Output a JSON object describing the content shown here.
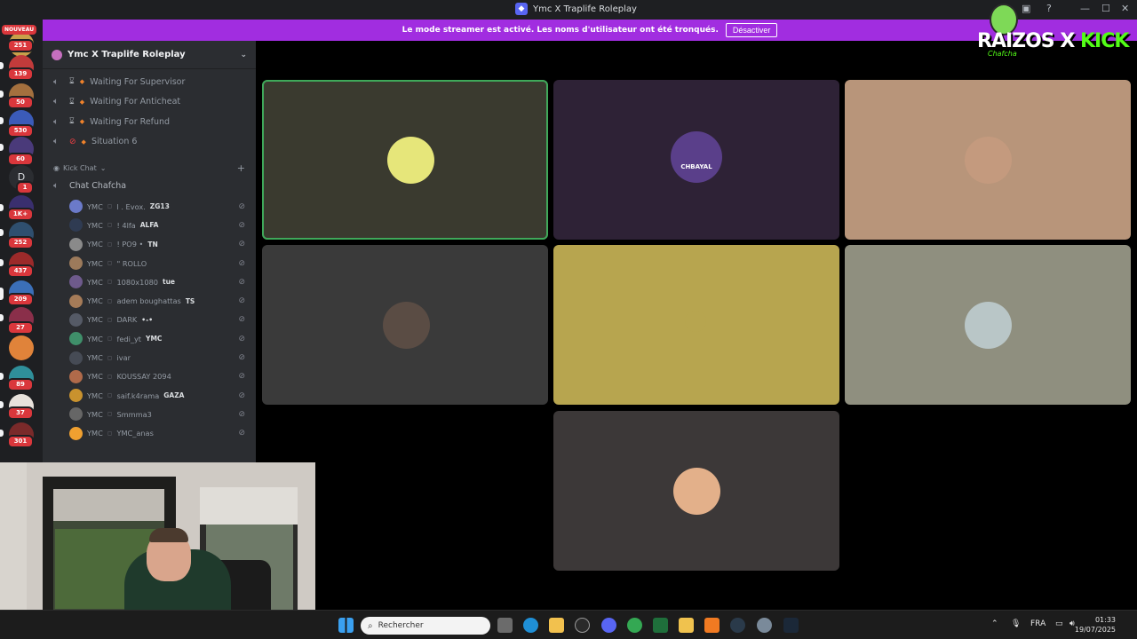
{
  "window": {
    "title": "Ymc X Traplife Roleplay",
    "minimize": "—",
    "maximize": "☐",
    "close": "✕"
  },
  "banner": {
    "text": "Le mode streamer est activé. Les noms d'utilisateur ont été tronqués.",
    "button": "Désactiver"
  },
  "overlay": {
    "left": "RAIZOS",
    "x": "X",
    "right": "KICK",
    "sub": "Chafcha"
  },
  "rail": {
    "new_badge": "NOUVEAU",
    "badges": [
      "251",
      "139",
      "50",
      "530",
      "60",
      "1",
      "1K+",
      "252",
      "437",
      "209",
      "27",
      "89",
      "37",
      "301"
    ],
    "letter": "D"
  },
  "server": {
    "name": "Ymc X Traplife Roleplay",
    "voice_channels": [
      {
        "label": "Waiting For Supervisor"
      },
      {
        "label": "Waiting For Anticheat"
      },
      {
        "label": "Waiting For Refund"
      },
      {
        "label": "Situation 6"
      }
    ],
    "category": "Kick Chat",
    "chat_channel": "Chat Chafcha",
    "members": [
      {
        "prefix": "YMC",
        "name": "l . Evox.",
        "tag": "ZG13",
        "color": "#6b7ac9"
      },
      {
        "prefix": "YMC",
        "name": "! 4lfa",
        "tag": "ALFA",
        "color": "#2f3b52"
      },
      {
        "prefix": "YMC",
        "name": "! PO9 •",
        "tag": "TN",
        "color": "#8a8a8a"
      },
      {
        "prefix": "YMC",
        "name": "\" ROLLO",
        "tag": "",
        "color": "#9c7a5b"
      },
      {
        "prefix": "YMC",
        "name": "1080x1080",
        "tag": "tue",
        "color": "#6e5a8c"
      },
      {
        "prefix": "YMC",
        "name": "adem boughattas",
        "tag": "TS",
        "color": "#a57b58"
      },
      {
        "prefix": "YMC",
        "name": "DARK",
        "tag": "•-•",
        "color": "#555a66"
      },
      {
        "prefix": "YMC",
        "name": "fedi_yt",
        "tag": "YMC",
        "color": "#3f8f6a"
      },
      {
        "prefix": "YMC",
        "name": "ivar",
        "tag": "",
        "color": "#464b55"
      },
      {
        "prefix": "YMC",
        "name": "KOUSSAY 2094",
        "tag": "",
        "color": "#b06a4a"
      },
      {
        "prefix": "YMC",
        "name": "saif.k4rama",
        "tag": "GAZA",
        "color": "#c9922e"
      },
      {
        "prefix": "YMC",
        "name": "Smmma3",
        "tag": "",
        "color": "#666"
      },
      {
        "prefix": "YMC",
        "name": "YMC_anas",
        "tag": "",
        "color": "#f0a030"
      }
    ]
  },
  "video_tiles": [
    {
      "bg": "#3a3a2f",
      "avatar": "#e6e67a",
      "speaking": true,
      "avatar_label": ""
    },
    {
      "bg": "#2e2236",
      "avatar": "#5a3f8a",
      "speaking": false,
      "avatar_label": "CHBAYAL"
    },
    {
      "bg": "#b8957a",
      "avatar": "#c49a7e",
      "speaking": false,
      "avatar_label": ""
    },
    {
      "bg": "#3a3a3a",
      "avatar": "#5a4c44",
      "speaking": false,
      "avatar_label": ""
    },
    {
      "bg": "#b7a54f",
      "avatar": "#b7a54f",
      "speaking": false,
      "avatar_label": ""
    },
    {
      "bg": "#8f8f7f",
      "avatar": "#b9c6c7",
      "speaking": false,
      "avatar_label": ""
    },
    {
      "bg": "#3c3838",
      "avatar": "#e3b08a",
      "speaking": false,
      "avatar_label": ""
    }
  ],
  "taskbar": {
    "search_placeholder": "Rechercher",
    "lang": "FRA",
    "time": "01:33",
    "date": "19/07/2025"
  }
}
